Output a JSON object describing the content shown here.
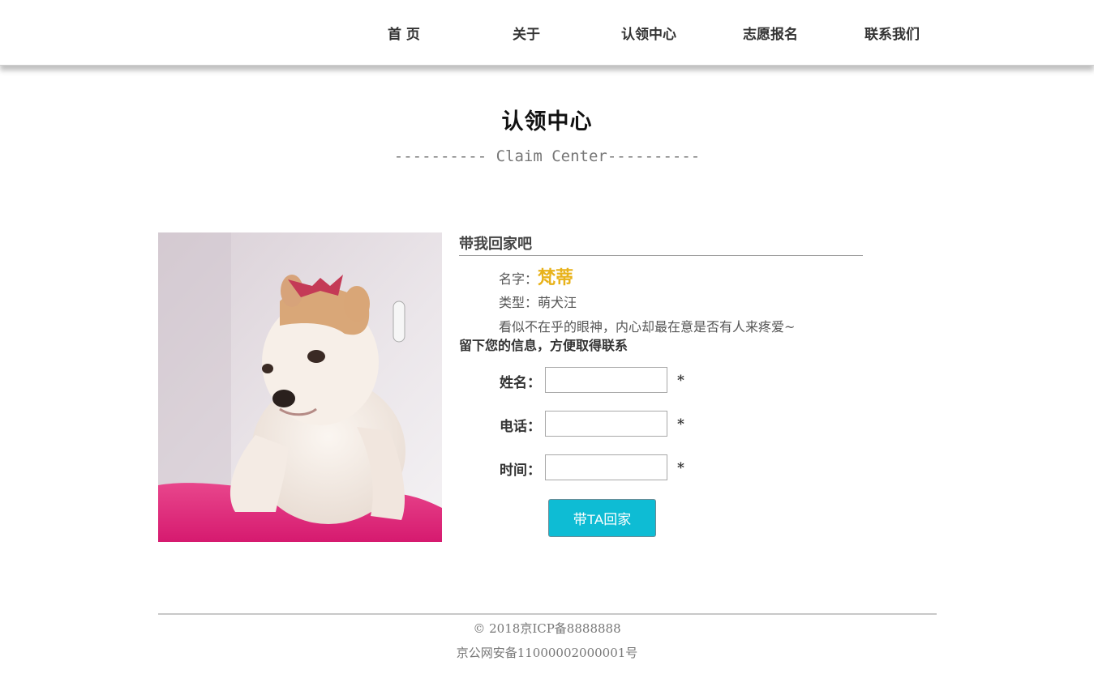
{
  "nav": {
    "items": [
      {
        "label": "首 页"
      },
      {
        "label": "关于"
      },
      {
        "label": "认领中心"
      },
      {
        "label": "志愿报名"
      },
      {
        "label": "联系我们"
      }
    ]
  },
  "page": {
    "title": "认领中心",
    "subtitle": "---------- Claim Center----------"
  },
  "card": {
    "heading": "带我回家吧",
    "name_label": "名字：",
    "name_value": "梵蒂",
    "type_text": "类型：萌犬汪",
    "description": "看似不在乎的眼神，内心却最在意是否有人来疼爱~"
  },
  "form": {
    "note": "留下您的信息，方便取得联系",
    "name_label": "姓名：",
    "phone_label": "电话：",
    "time_label": "时间：",
    "name_value": "",
    "phone_value": "",
    "time_value": "",
    "required_mark": "*",
    "submit_label": "带TA回家"
  },
  "footer": {
    "copyright": "© 2018京ICP备8888888",
    "record": "京公网安备11000002000001号"
  },
  "colors": {
    "accent": "#0ebcd4",
    "name_highlight": "#e8b21a"
  }
}
